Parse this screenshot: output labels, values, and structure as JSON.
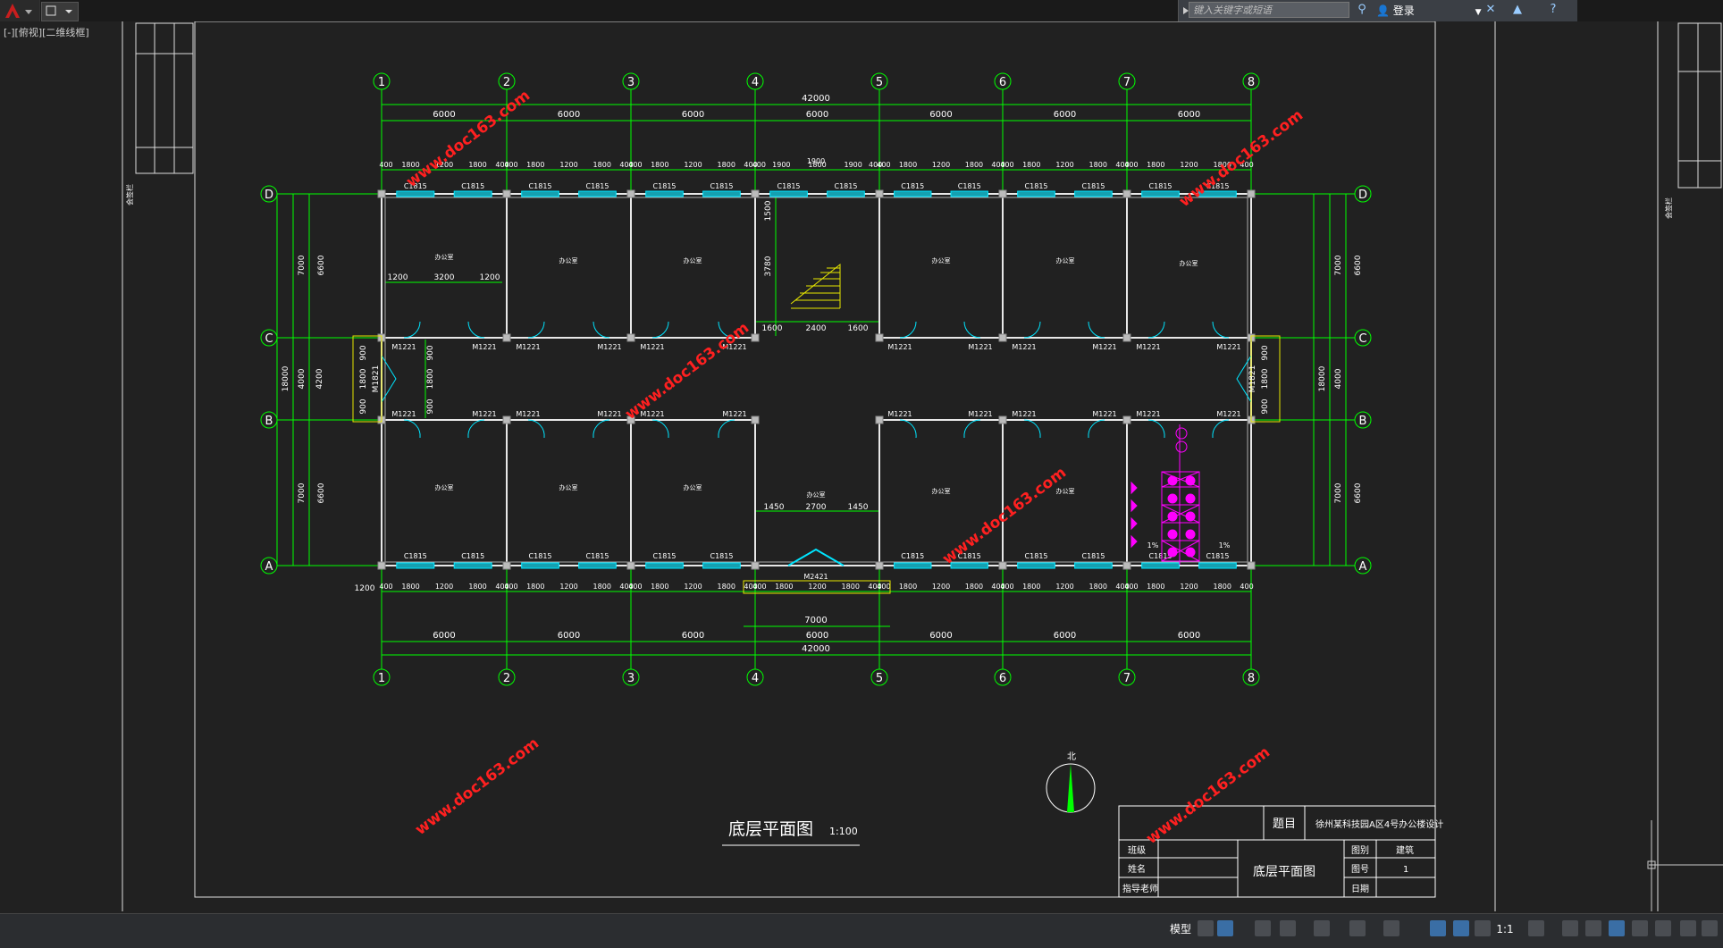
{
  "toolbar": {
    "search_placeholder": "键入关键字或短语",
    "login_label": "登录"
  },
  "viewport": {
    "label": "[-][俯视][二维线框]"
  },
  "drawing": {
    "title": "底层平面图",
    "scale": "1:100",
    "north_label": "北",
    "total_dim": "42000",
    "bay_dim": "6000",
    "axes_x": [
      "1",
      "2",
      "3",
      "4",
      "5",
      "6",
      "7",
      "8"
    ],
    "axes_y": [
      "D",
      "C",
      "B",
      "A"
    ],
    "vertical_dims_left": [
      "7000",
      "4000",
      "7000",
      "18000",
      "6600",
      "6600",
      "4200"
    ],
    "window_label": "C1815",
    "door_label": "M1221",
    "door_side": "M1821",
    "main_door": "M2421",
    "stair_dims": [
      "1500",
      "3780",
      "1600",
      "2400",
      "1600"
    ],
    "entrance_dim": "7000",
    "room_label": "办公室",
    "slope_label": "1%",
    "window_seg_dims": [
      "400",
      "1800",
      "1200",
      "1800",
      "400",
      "1800",
      "1200",
      "1800",
      "400"
    ],
    "stair_width": "1900",
    "corridor_dims": [
      "1200",
      "3200",
      "1200"
    ],
    "lobby_dims": [
      "1450",
      "2700",
      "1450"
    ],
    "side_dims": [
      "900",
      "1800",
      "900"
    ],
    "first_segment": "1200",
    "watermark": "www.doc163.com"
  },
  "title_block": {
    "topic_label": "题目",
    "topic_value": "徐州某科技园A区4号办公楼设计",
    "drawing_name": "底层平面图",
    "class_label": "班级",
    "name_label": "姓名",
    "advisor_label": "指导老师",
    "chart_label": "图别",
    "chart_value": "建筑",
    "number_label": "图号",
    "number_value": "1",
    "date_label": "日期"
  },
  "margin_labels": {
    "left_vertical": "会签栏",
    "right_vertical": "会签栏"
  },
  "statusbar": {
    "model_label": "模型",
    "scale_label": "1:1"
  },
  "colors": {
    "background": "#212121",
    "dimension": "#00ff00",
    "wall": "#ffffff",
    "door": "#00e5ff",
    "text": "#ffffff",
    "sanitary": "#ff00ff",
    "stair": "#ffff00",
    "watermark": "#ff2020"
  }
}
